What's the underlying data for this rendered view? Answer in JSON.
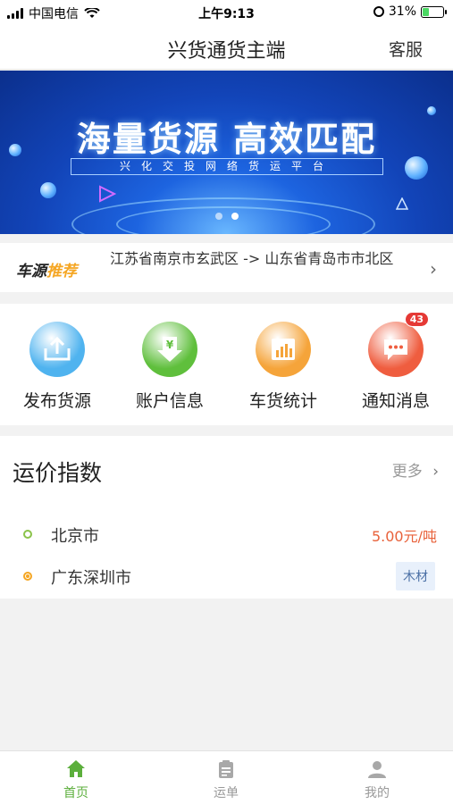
{
  "status_bar": {
    "carrier": "中国电信",
    "time": "上午9:13",
    "battery": "31%",
    "battery_level": 0.31
  },
  "header": {
    "title": "兴货通货主端",
    "service_label": "客服"
  },
  "banner": {
    "headline": "海量货源 高效匹配",
    "subline": "兴化交投网络货运平台",
    "slide_count": 2,
    "active_slide": 2
  },
  "recommend": {
    "tag_black": "车源",
    "tag_orange": "推荐",
    "route": "江苏省南京市玄武区 -> 山东省青岛市市北区"
  },
  "features": [
    {
      "label": "发布货源",
      "icon": "upload-icon",
      "color": "#4fb3ef"
    },
    {
      "label": "账户信息",
      "icon": "yen-download-icon",
      "color": "#5fbf3c"
    },
    {
      "label": "车货统计",
      "icon": "bar-chart-icon",
      "color": "#f5a43a"
    },
    {
      "label": "通知消息",
      "icon": "message-icon",
      "color": "#ef5d3f",
      "badge": "43"
    }
  ],
  "freight_index": {
    "title": "运价指数",
    "more_label": "更多",
    "rows": [
      {
        "city": "北京市",
        "value": "5.00元/吨"
      },
      {
        "city": "广东深圳市",
        "value": "木材"
      }
    ]
  },
  "tabbar": [
    {
      "label": "首页",
      "icon": "home-icon",
      "active": true
    },
    {
      "label": "运单",
      "icon": "clipboard-icon",
      "active": false
    },
    {
      "label": "我的",
      "icon": "user-icon",
      "active": false
    }
  ]
}
